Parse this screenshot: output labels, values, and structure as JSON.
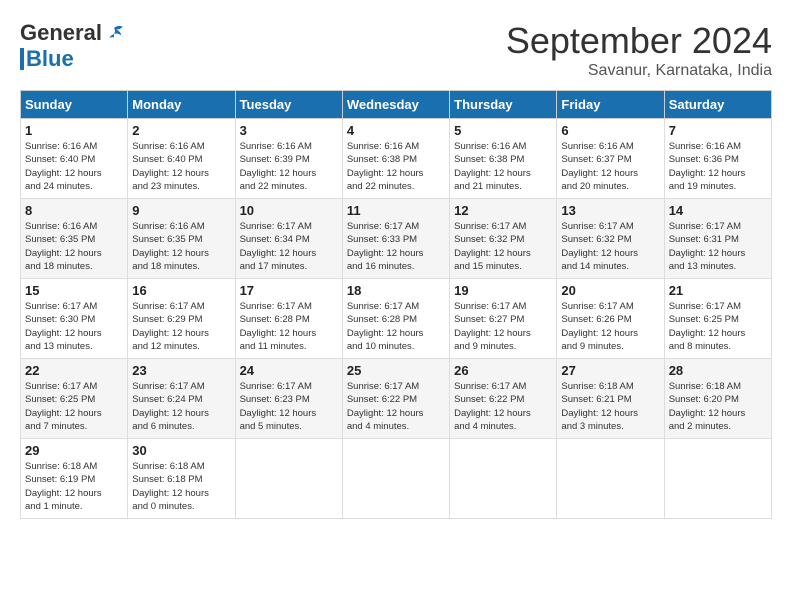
{
  "header": {
    "logo_general": "General",
    "logo_blue": "Blue",
    "month_title": "September 2024",
    "subtitle": "Savanur, Karnataka, India"
  },
  "weekdays": [
    "Sunday",
    "Monday",
    "Tuesday",
    "Wednesday",
    "Thursday",
    "Friday",
    "Saturday"
  ],
  "weeks": [
    [
      {
        "day": "1",
        "sunrise": "6:16 AM",
        "sunset": "6:40 PM",
        "daylight": "12 hours and 24 minutes."
      },
      {
        "day": "2",
        "sunrise": "6:16 AM",
        "sunset": "6:40 PM",
        "daylight": "12 hours and 23 minutes."
      },
      {
        "day": "3",
        "sunrise": "6:16 AM",
        "sunset": "6:39 PM",
        "daylight": "12 hours and 22 minutes."
      },
      {
        "day": "4",
        "sunrise": "6:16 AM",
        "sunset": "6:38 PM",
        "daylight": "12 hours and 22 minutes."
      },
      {
        "day": "5",
        "sunrise": "6:16 AM",
        "sunset": "6:38 PM",
        "daylight": "12 hours and 21 minutes."
      },
      {
        "day": "6",
        "sunrise": "6:16 AM",
        "sunset": "6:37 PM",
        "daylight": "12 hours and 20 minutes."
      },
      {
        "day": "7",
        "sunrise": "6:16 AM",
        "sunset": "6:36 PM",
        "daylight": "12 hours and 19 minutes."
      }
    ],
    [
      {
        "day": "8",
        "sunrise": "6:16 AM",
        "sunset": "6:35 PM",
        "daylight": "12 hours and 18 minutes."
      },
      {
        "day": "9",
        "sunrise": "6:16 AM",
        "sunset": "6:35 PM",
        "daylight": "12 hours and 18 minutes."
      },
      {
        "day": "10",
        "sunrise": "6:17 AM",
        "sunset": "6:34 PM",
        "daylight": "12 hours and 17 minutes."
      },
      {
        "day": "11",
        "sunrise": "6:17 AM",
        "sunset": "6:33 PM",
        "daylight": "12 hours and 16 minutes."
      },
      {
        "day": "12",
        "sunrise": "6:17 AM",
        "sunset": "6:32 PM",
        "daylight": "12 hours and 15 minutes."
      },
      {
        "day": "13",
        "sunrise": "6:17 AM",
        "sunset": "6:32 PM",
        "daylight": "12 hours and 14 minutes."
      },
      {
        "day": "14",
        "sunrise": "6:17 AM",
        "sunset": "6:31 PM",
        "daylight": "12 hours and 13 minutes."
      }
    ],
    [
      {
        "day": "15",
        "sunrise": "6:17 AM",
        "sunset": "6:30 PM",
        "daylight": "12 hours and 13 minutes."
      },
      {
        "day": "16",
        "sunrise": "6:17 AM",
        "sunset": "6:29 PM",
        "daylight": "12 hours and 12 minutes."
      },
      {
        "day": "17",
        "sunrise": "6:17 AM",
        "sunset": "6:28 PM",
        "daylight": "12 hours and 11 minutes."
      },
      {
        "day": "18",
        "sunrise": "6:17 AM",
        "sunset": "6:28 PM",
        "daylight": "12 hours and 10 minutes."
      },
      {
        "day": "19",
        "sunrise": "6:17 AM",
        "sunset": "6:27 PM",
        "daylight": "12 hours and 9 minutes."
      },
      {
        "day": "20",
        "sunrise": "6:17 AM",
        "sunset": "6:26 PM",
        "daylight": "12 hours and 9 minutes."
      },
      {
        "day": "21",
        "sunrise": "6:17 AM",
        "sunset": "6:25 PM",
        "daylight": "12 hours and 8 minutes."
      }
    ],
    [
      {
        "day": "22",
        "sunrise": "6:17 AM",
        "sunset": "6:25 PM",
        "daylight": "12 hours and 7 minutes."
      },
      {
        "day": "23",
        "sunrise": "6:17 AM",
        "sunset": "6:24 PM",
        "daylight": "12 hours and 6 minutes."
      },
      {
        "day": "24",
        "sunrise": "6:17 AM",
        "sunset": "6:23 PM",
        "daylight": "12 hours and 5 minutes."
      },
      {
        "day": "25",
        "sunrise": "6:17 AM",
        "sunset": "6:22 PM",
        "daylight": "12 hours and 4 minutes."
      },
      {
        "day": "26",
        "sunrise": "6:17 AM",
        "sunset": "6:22 PM",
        "daylight": "12 hours and 4 minutes."
      },
      {
        "day": "27",
        "sunrise": "6:18 AM",
        "sunset": "6:21 PM",
        "daylight": "12 hours and 3 minutes."
      },
      {
        "day": "28",
        "sunrise": "6:18 AM",
        "sunset": "6:20 PM",
        "daylight": "12 hours and 2 minutes."
      }
    ],
    [
      {
        "day": "29",
        "sunrise": "6:18 AM",
        "sunset": "6:19 PM",
        "daylight": "12 hours and 1 minute."
      },
      {
        "day": "30",
        "sunrise": "6:18 AM",
        "sunset": "6:18 PM",
        "daylight": "12 hours and 0 minutes."
      },
      null,
      null,
      null,
      null,
      null
    ]
  ]
}
